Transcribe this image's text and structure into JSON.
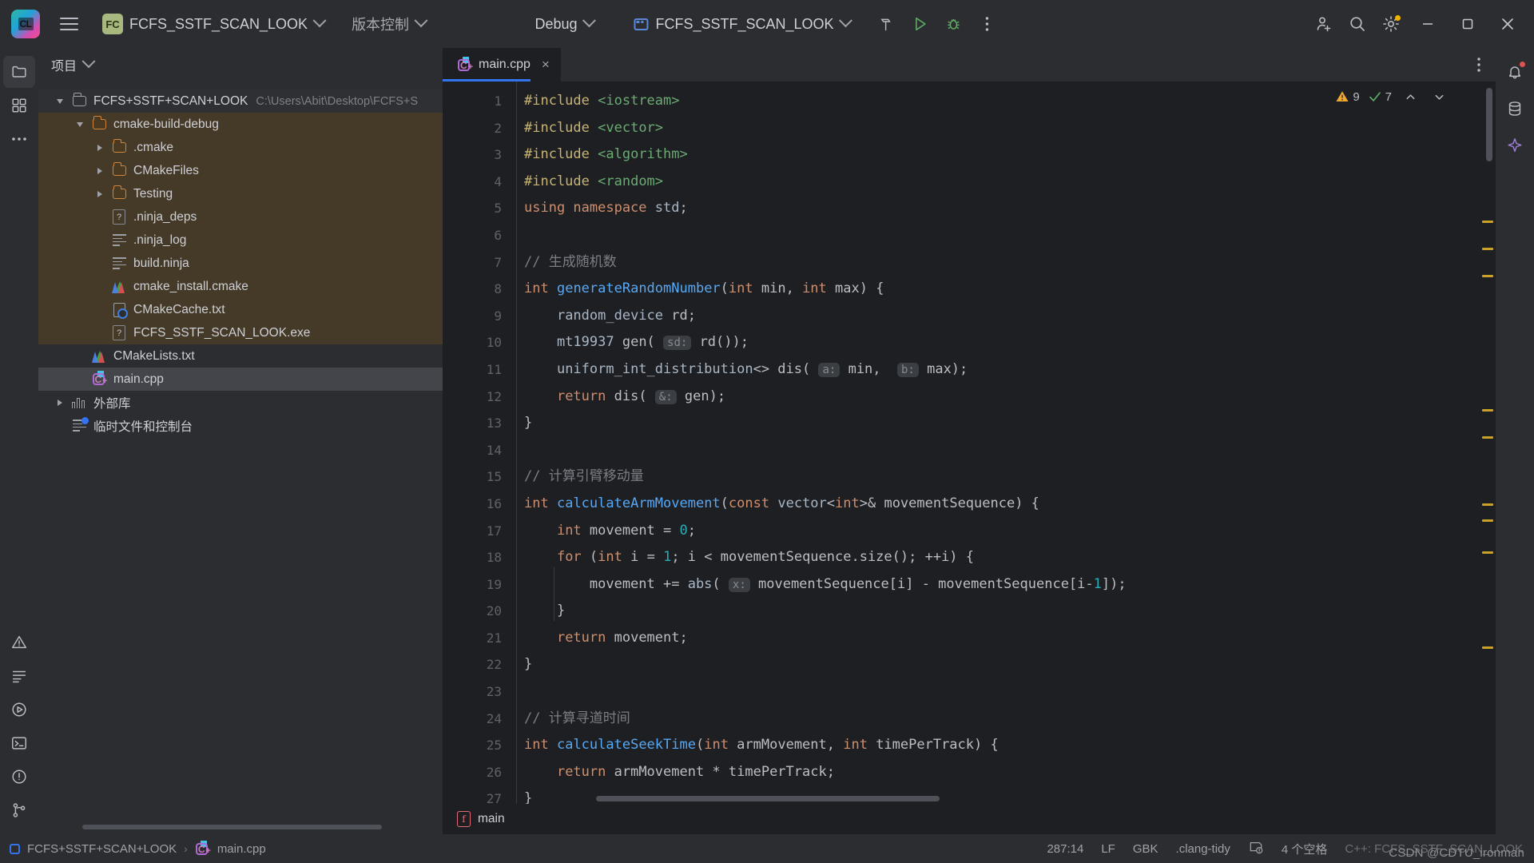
{
  "titlebar": {
    "menu_icon": "hamburger-icon",
    "logo": "clion-logo",
    "project_chip": "FC",
    "project_name": "FCFS_SSTF_SCAN_LOOK",
    "vcs_label": "版本控制",
    "run_config_label": "Debug",
    "run_target_label": "FCFS_SSTF_SCAN_LOOK",
    "icons": [
      "hammer-icon",
      "run-icon",
      "debug-icon",
      "more-vertical-icon"
    ],
    "right_icons": [
      "add-user-icon",
      "search-icon",
      "settings-gear-icon"
    ],
    "window_controls": [
      "minimize-icon",
      "maximize-icon",
      "close-icon"
    ]
  },
  "rail": {
    "top": [
      "project-folder-icon",
      "structure-icon",
      "more-tool-windows-icon"
    ],
    "bottom": [
      "problems-icon",
      "todo-icon",
      "run-icon",
      "terminal-icon",
      "notifications-icon",
      "git-branch-icon"
    ]
  },
  "right_rail": [
    "notifications-bell-icon",
    "database-icon",
    "ai-assistant-icon"
  ],
  "project_pane": {
    "title": "项目",
    "tree": [
      {
        "label": "FCFS+SSTF+SCAN+LOOK",
        "path": "C:\\Users\\Abit\\Desktop\\FCFS+S",
        "icon": "project-root-icon",
        "depth": 0,
        "arrow": "open",
        "state": "root"
      },
      {
        "label": "cmake-build-debug",
        "path": "",
        "icon": "folder-icon",
        "depth": 1,
        "arrow": "open",
        "state": "build"
      },
      {
        "label": ".cmake",
        "path": "",
        "icon": "folder-icon",
        "depth": 2,
        "arrow": "closed",
        "state": "build"
      },
      {
        "label": "CMakeFiles",
        "path": "",
        "icon": "folder-icon",
        "depth": 2,
        "arrow": "closed",
        "state": "build"
      },
      {
        "label": "Testing",
        "path": "",
        "icon": "folder-icon",
        "depth": 2,
        "arrow": "closed",
        "state": "build"
      },
      {
        "label": ".ninja_deps",
        "path": "",
        "icon": "unknown-file-icon",
        "depth": 2,
        "arrow": "none",
        "state": "build"
      },
      {
        "label": ".ninja_log",
        "path": "",
        "icon": "text-file-icon",
        "depth": 2,
        "arrow": "none",
        "state": "build"
      },
      {
        "label": "build.ninja",
        "path": "",
        "icon": "text-file-icon",
        "depth": 2,
        "arrow": "none",
        "state": "build"
      },
      {
        "label": "cmake_install.cmake",
        "path": "",
        "icon": "cmake-file-icon",
        "depth": 2,
        "arrow": "none",
        "state": "build"
      },
      {
        "label": "CMakeCache.txt",
        "path": "",
        "icon": "cmake-cache-icon",
        "depth": 2,
        "arrow": "none",
        "state": "build"
      },
      {
        "label": "FCFS_SSTF_SCAN_LOOK.exe",
        "path": "",
        "icon": "unknown-file-icon",
        "depth": 2,
        "arrow": "none",
        "state": "build"
      },
      {
        "label": "CMakeLists.txt",
        "path": "",
        "icon": "cmake-file-icon",
        "depth": 1,
        "arrow": "none",
        "state": "normal"
      },
      {
        "label": "main.cpp",
        "path": "",
        "icon": "cpp-file-icon",
        "depth": 1,
        "arrow": "none",
        "state": "selected"
      },
      {
        "label": "外部库",
        "path": "",
        "icon": "external-libraries-icon",
        "depth": 0,
        "arrow": "closed",
        "state": "normal"
      },
      {
        "label": "临时文件和控制台",
        "path": "",
        "icon": "scratches-icon",
        "depth": 0,
        "arrow": "none",
        "state": "normal"
      }
    ]
  },
  "editor": {
    "tab": {
      "label": "main.cpp",
      "icon": "cpp-file-icon",
      "close": "×"
    },
    "more_icon": "more-vertical-icon",
    "inspections": {
      "warning_icon": "warning-triangle-icon",
      "warning_count": "9",
      "check_icon": "check-mark-icon",
      "check_count": "7",
      "up_icon": "chevron-up-icon",
      "down_icon": "chevron-down-icon"
    },
    "first_line": 1,
    "lines": [
      {
        "n": 1,
        "html": "<span class='inc'>#include</span> <span class='str'>&lt;iostream&gt;</span>"
      },
      {
        "n": 2,
        "html": "<span class='inc'>#include</span> <span class='str'>&lt;vector&gt;</span>"
      },
      {
        "n": 3,
        "html": "<span class='inc'>#include</span> <span class='str'>&lt;algorithm&gt;</span>"
      },
      {
        "n": 4,
        "html": "<span class='inc'>#include</span> <span class='str'>&lt;random&gt;</span>"
      },
      {
        "n": 5,
        "html": "<span class='k'>using namespace</span> <span class='stdc'>std</span>;"
      },
      {
        "n": 6,
        "html": ""
      },
      {
        "n": 7,
        "html": "<span class='cm'>// 生成随机数</span>"
      },
      {
        "n": 8,
        "html": "<span class='k'>int</span> <span class='fn'>generateRandomNumber</span>(<span class='k'>int</span> min, <span class='k'>int</span> max) {"
      },
      {
        "n": 9,
        "html": "    <span class='stdc'>random_device</span> rd;"
      },
      {
        "n": 10,
        "html": "    <span class='stdc'>mt19937</span> gen( <span class='hint'>sd:</span> rd());"
      },
      {
        "n": 11,
        "html": "    <span class='stdc'>uniform_int_distribution</span>&lt;&gt; dis( <span class='hint'>a:</span> min,  <span class='hint'>b:</span> max);"
      },
      {
        "n": 12,
        "html": "    <span class='k'>return</span> dis( <span class='hint'>&amp;:</span> gen);"
      },
      {
        "n": 13,
        "html": "}"
      },
      {
        "n": 14,
        "html": ""
      },
      {
        "n": 15,
        "html": "<span class='cm'>// 计算引臂移动量</span>"
      },
      {
        "n": 16,
        "html": "<span class='k'>int</span> <span class='fn'>calculateArmMovement</span>(<span class='k'>const</span> <span class='stdc'>vector</span>&lt;<span class='k'>int</span>&gt;&amp; movementSequence) {"
      },
      {
        "n": 17,
        "html": "    <span class='k'>int</span> movement = <span class='num'>0</span>;"
      },
      {
        "n": 18,
        "html": "    <span class='k'>for</span> (<span class='k'>int</span> i = <span class='num'>1</span>; i &lt; movementSequence.size(); ++i) {"
      },
      {
        "n": 19,
        "html": "        movement += <span class='stdc'>abs</span>( <span class='hint'>x:</span> movementSequence[i] - movementSequence[i-<span class='num'>1</span>]);"
      },
      {
        "n": 20,
        "html": "    }"
      },
      {
        "n": 21,
        "html": "    <span class='k'>return</span> movement;"
      },
      {
        "n": 22,
        "html": "}"
      },
      {
        "n": 23,
        "html": ""
      },
      {
        "n": 24,
        "html": "<span class='cm'>// 计算寻道时间</span>"
      },
      {
        "n": 25,
        "html": "<span class='k'>int</span> <span class='fn'>calculateSeekTime</span>(<span class='k'>int</span> armMovement, <span class='k'>int</span> timePerTrack) {"
      },
      {
        "n": 26,
        "html": "    <span class='k'>return</span> armMovement * timePerTrack;"
      },
      {
        "n": 27,
        "html": "}"
      }
    ],
    "breadcrumb": {
      "icon": "function-icon",
      "label": "main"
    }
  },
  "statusbar": {
    "breadcrumb_project": "FCFS+SSTF+SCAN+LOOK",
    "breadcrumb_sep": "›",
    "breadcrumb_file": "main.cpp",
    "caret": "287:14",
    "line_separator": "LF",
    "encoding": "GBK",
    "clang_tidy": ".clang-tidy",
    "inspections_icon": "inspection-widget-icon",
    "indent": "4 个空格",
    "language_config": "C++: FCFS_SSTF_SCAN_LOOK",
    "watermark": "CSDN @CDTU_ironman"
  },
  "colors": {
    "accent_blue": "#3574f0",
    "build_highlight": "#453a28",
    "titlebar_bg": "#2b2d30",
    "editor_bg": "#1e1f22",
    "keyword": "#cf8e6d",
    "function": "#56a8f5",
    "string": "#6aab73",
    "comment": "#7a7e85",
    "include": "#c9b472"
  }
}
